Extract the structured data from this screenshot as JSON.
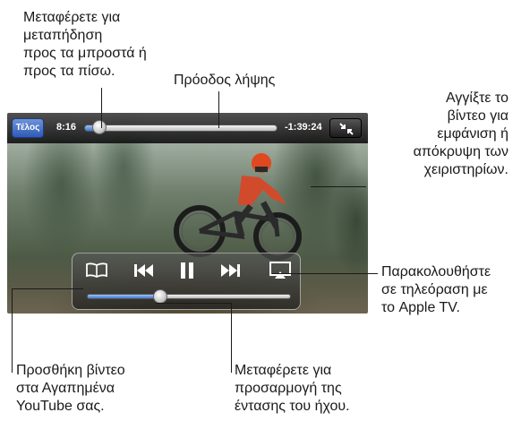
{
  "callouts": {
    "scrub": "Μεταφέρετε για\nμεταπήδηση\nπρος τα μπροστά ή\nπρος τα πίσω.",
    "download_progress": "Πρόοδος λήψης",
    "tap_video": "Αγγίξτε το\nβίντεο για\nεμφάνιση ή\nαπόκρυψη των\nχειριστηρίων.",
    "apple_tv": "Παρακολουθήστε\nσε τηλεόραση με\nτο Apple TV.",
    "favorites": "Προσθήκη βίντεο\nστα Αγαπημένα\nYouTube σας.",
    "volume": "Μεταφέρετε για\nπροσαρμογή της\nέντασης του ήχου."
  },
  "player": {
    "done_label": "Τέλος",
    "elapsed": "8:16",
    "remaining": "-1:39:24",
    "playback_progress": 0.08,
    "volume_level": 0.36
  },
  "icons": {
    "fullscreen": "exit-fullscreen-icon",
    "bookmark": "book-icon",
    "previous": "previous-track-icon",
    "pause": "pause-icon",
    "next": "next-track-icon",
    "airplay": "airplay-icon"
  }
}
